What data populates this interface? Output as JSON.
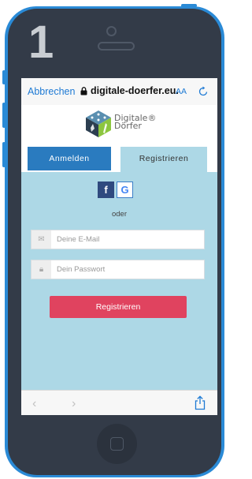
{
  "step_number": "1",
  "browser": {
    "cancel_label": "Abbrechen",
    "domain": "digitale-doerfer.eu.",
    "text_size_label": "AA",
    "back_icon": "chevron-left-icon",
    "forward_icon": "chevron-right-icon",
    "share_icon": "share-icon"
  },
  "logo": {
    "line1": "Digitale®",
    "line2": "Dörfer"
  },
  "tabs": {
    "login": "Anmelden",
    "register": "Registrieren"
  },
  "social": {
    "facebook": "f",
    "google": "G"
  },
  "divider": "oder",
  "form": {
    "email_placeholder": "Deine E-Mail",
    "password_placeholder": "Dein Passwort",
    "submit_label": "Registrieren"
  },
  "colors": {
    "accent_blue": "#2a7bbf",
    "submit_red": "#e0435f",
    "panel_bg": "#add8e6",
    "phone_frame": "#2a8ad6"
  }
}
